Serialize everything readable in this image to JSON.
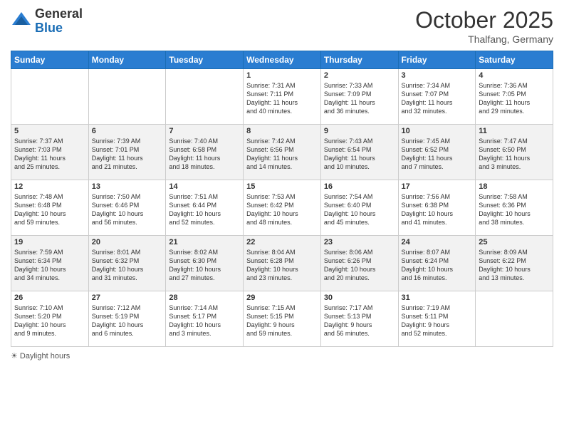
{
  "logo": {
    "general": "General",
    "blue": "Blue"
  },
  "title": "October 2025",
  "location": "Thalfang, Germany",
  "days_header": [
    "Sunday",
    "Monday",
    "Tuesday",
    "Wednesday",
    "Thursday",
    "Friday",
    "Saturday"
  ],
  "weeks": [
    [
      {
        "day": "",
        "info": ""
      },
      {
        "day": "",
        "info": ""
      },
      {
        "day": "",
        "info": ""
      },
      {
        "day": "1",
        "info": "Sunrise: 7:31 AM\nSunset: 7:11 PM\nDaylight: 11 hours\nand 40 minutes."
      },
      {
        "day": "2",
        "info": "Sunrise: 7:33 AM\nSunset: 7:09 PM\nDaylight: 11 hours\nand 36 minutes."
      },
      {
        "day": "3",
        "info": "Sunrise: 7:34 AM\nSunset: 7:07 PM\nDaylight: 11 hours\nand 32 minutes."
      },
      {
        "day": "4",
        "info": "Sunrise: 7:36 AM\nSunset: 7:05 PM\nDaylight: 11 hours\nand 29 minutes."
      }
    ],
    [
      {
        "day": "5",
        "info": "Sunrise: 7:37 AM\nSunset: 7:03 PM\nDaylight: 11 hours\nand 25 minutes."
      },
      {
        "day": "6",
        "info": "Sunrise: 7:39 AM\nSunset: 7:01 PM\nDaylight: 11 hours\nand 21 minutes."
      },
      {
        "day": "7",
        "info": "Sunrise: 7:40 AM\nSunset: 6:58 PM\nDaylight: 11 hours\nand 18 minutes."
      },
      {
        "day": "8",
        "info": "Sunrise: 7:42 AM\nSunset: 6:56 PM\nDaylight: 11 hours\nand 14 minutes."
      },
      {
        "day": "9",
        "info": "Sunrise: 7:43 AM\nSunset: 6:54 PM\nDaylight: 11 hours\nand 10 minutes."
      },
      {
        "day": "10",
        "info": "Sunrise: 7:45 AM\nSunset: 6:52 PM\nDaylight: 11 hours\nand 7 minutes."
      },
      {
        "day": "11",
        "info": "Sunrise: 7:47 AM\nSunset: 6:50 PM\nDaylight: 11 hours\nand 3 minutes."
      }
    ],
    [
      {
        "day": "12",
        "info": "Sunrise: 7:48 AM\nSunset: 6:48 PM\nDaylight: 10 hours\nand 59 minutes."
      },
      {
        "day": "13",
        "info": "Sunrise: 7:50 AM\nSunset: 6:46 PM\nDaylight: 10 hours\nand 56 minutes."
      },
      {
        "day": "14",
        "info": "Sunrise: 7:51 AM\nSunset: 6:44 PM\nDaylight: 10 hours\nand 52 minutes."
      },
      {
        "day": "15",
        "info": "Sunrise: 7:53 AM\nSunset: 6:42 PM\nDaylight: 10 hours\nand 48 minutes."
      },
      {
        "day": "16",
        "info": "Sunrise: 7:54 AM\nSunset: 6:40 PM\nDaylight: 10 hours\nand 45 minutes."
      },
      {
        "day": "17",
        "info": "Sunrise: 7:56 AM\nSunset: 6:38 PM\nDaylight: 10 hours\nand 41 minutes."
      },
      {
        "day": "18",
        "info": "Sunrise: 7:58 AM\nSunset: 6:36 PM\nDaylight: 10 hours\nand 38 minutes."
      }
    ],
    [
      {
        "day": "19",
        "info": "Sunrise: 7:59 AM\nSunset: 6:34 PM\nDaylight: 10 hours\nand 34 minutes."
      },
      {
        "day": "20",
        "info": "Sunrise: 8:01 AM\nSunset: 6:32 PM\nDaylight: 10 hours\nand 31 minutes."
      },
      {
        "day": "21",
        "info": "Sunrise: 8:02 AM\nSunset: 6:30 PM\nDaylight: 10 hours\nand 27 minutes."
      },
      {
        "day": "22",
        "info": "Sunrise: 8:04 AM\nSunset: 6:28 PM\nDaylight: 10 hours\nand 23 minutes."
      },
      {
        "day": "23",
        "info": "Sunrise: 8:06 AM\nSunset: 6:26 PM\nDaylight: 10 hours\nand 20 minutes."
      },
      {
        "day": "24",
        "info": "Sunrise: 8:07 AM\nSunset: 6:24 PM\nDaylight: 10 hours\nand 16 minutes."
      },
      {
        "day": "25",
        "info": "Sunrise: 8:09 AM\nSunset: 6:22 PM\nDaylight: 10 hours\nand 13 minutes."
      }
    ],
    [
      {
        "day": "26",
        "info": "Sunrise: 7:10 AM\nSunset: 5:20 PM\nDaylight: 10 hours\nand 9 minutes."
      },
      {
        "day": "27",
        "info": "Sunrise: 7:12 AM\nSunset: 5:19 PM\nDaylight: 10 hours\nand 6 minutes."
      },
      {
        "day": "28",
        "info": "Sunrise: 7:14 AM\nSunset: 5:17 PM\nDaylight: 10 hours\nand 3 minutes."
      },
      {
        "day": "29",
        "info": "Sunrise: 7:15 AM\nSunset: 5:15 PM\nDaylight: 9 hours\nand 59 minutes."
      },
      {
        "day": "30",
        "info": "Sunrise: 7:17 AM\nSunset: 5:13 PM\nDaylight: 9 hours\nand 56 minutes."
      },
      {
        "day": "31",
        "info": "Sunrise: 7:19 AM\nSunset: 5:11 PM\nDaylight: 9 hours\nand 52 minutes."
      },
      {
        "day": "",
        "info": ""
      }
    ]
  ],
  "legend": "Daylight hours"
}
